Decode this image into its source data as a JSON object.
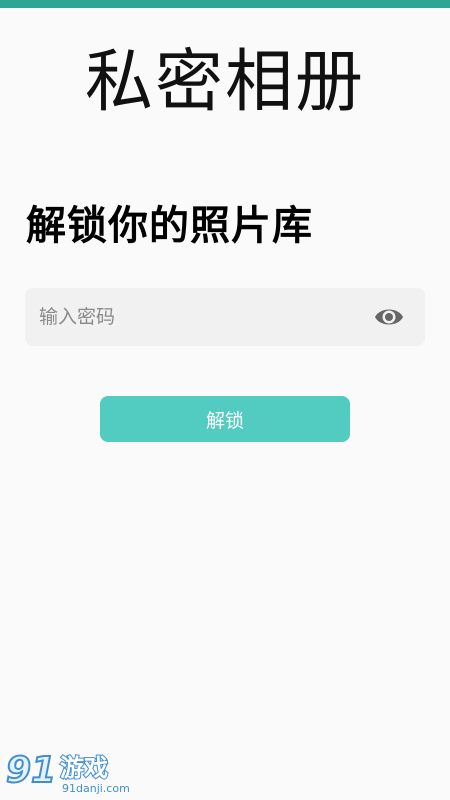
{
  "app": {
    "title": "私密相册",
    "subtitle": "解锁你的照片库"
  },
  "password": {
    "placeholder": "输入密码",
    "value": "",
    "visibility_icon": "eye-icon"
  },
  "unlock_button": {
    "label": "解锁"
  },
  "watermark": {
    "logo_text": "91游戏",
    "site": "91danji.com"
  },
  "colors": {
    "status_strip": "#2fa594",
    "accent": "#52cbc0",
    "background": "#fafafa",
    "input_bg": "#f1f1f1"
  }
}
